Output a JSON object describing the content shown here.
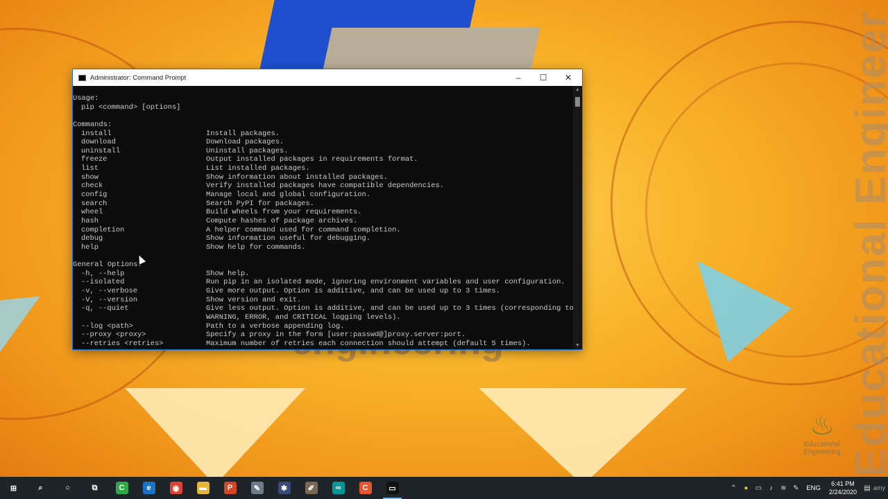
{
  "window": {
    "title": "Administrator: Command Prompt",
    "controls": {
      "minimize": "–",
      "maximize": "☐",
      "close": "✕"
    }
  },
  "console": {
    "usage_header": "Usage:",
    "usage_line": "pip <command> [options]",
    "commands_header": "Commands:",
    "commands": [
      {
        "name": "install",
        "desc": "Install packages."
      },
      {
        "name": "download",
        "desc": "Download packages."
      },
      {
        "name": "uninstall",
        "desc": "Uninstall packages."
      },
      {
        "name": "freeze",
        "desc": "Output installed packages in requirements format."
      },
      {
        "name": "list",
        "desc": "List installed packages."
      },
      {
        "name": "show",
        "desc": "Show information about installed packages."
      },
      {
        "name": "check",
        "desc": "Verify installed packages have compatible dependencies."
      },
      {
        "name": "config",
        "desc": "Manage local and global configuration."
      },
      {
        "name": "search",
        "desc": "Search PyPI for packages."
      },
      {
        "name": "wheel",
        "desc": "Build wheels from your requirements."
      },
      {
        "name": "hash",
        "desc": "Compute hashes of package archives."
      },
      {
        "name": "completion",
        "desc": "A helper command used for command completion."
      },
      {
        "name": "debug",
        "desc": "Show information useful for debugging."
      },
      {
        "name": "help",
        "desc": "Show help for commands."
      }
    ],
    "options_header": "General Options:",
    "options": [
      {
        "name": "-h, --help",
        "desc": "Show help."
      },
      {
        "name": "--isolated",
        "desc": "Run pip in an isolated mode, ignoring environment variables and user configuration."
      },
      {
        "name": "-v, --verbose",
        "desc": "Give more output. Option is additive, and can be used up to 3 times."
      },
      {
        "name": "-V, --version",
        "desc": "Show version and exit."
      },
      {
        "name": "-q, --quiet",
        "desc": "Give less output. Option is additive, and can be used up to 3 times (corresponding to"
      },
      {
        "name": "",
        "desc": "WARNING, ERROR, and CRITICAL logging levels)."
      },
      {
        "name": "--log <path>",
        "desc": "Path to a verbose appending log."
      },
      {
        "name": "--proxy <proxy>",
        "desc": "Specify a proxy in the form [user:passwd@]proxy.server:port."
      },
      {
        "name": "--retries <retries>",
        "desc": "Maximum number of retries each connection should attempt (default 5 times)."
      }
    ]
  },
  "wallpaper": {
    "text_right": "Educational Engineer",
    "text_bottom": "engineering",
    "logo_line1": "Educational",
    "logo_line2": "Engineering"
  },
  "taskbar": {
    "items": [
      {
        "name": "start-button",
        "icon": "windows-logo",
        "glyph": "⊞",
        "color": "#1f2429",
        "active": false
      },
      {
        "name": "search-button",
        "icon": "search-icon",
        "glyph": "⌕",
        "color": "#1f2429",
        "active": false
      },
      {
        "name": "cortana-button",
        "icon": "cortana-icon",
        "glyph": "○",
        "color": "#1f2429",
        "active": false
      },
      {
        "name": "task-view-button",
        "icon": "task-view-icon",
        "glyph": "⧉",
        "color": "#1f2429",
        "active": false
      },
      {
        "name": "taskbar-app-camtasia",
        "icon": "camtasia-icon",
        "glyph": "C",
        "color": "#2fa84a",
        "active": false
      },
      {
        "name": "taskbar-app-edge",
        "icon": "edge-icon",
        "glyph": "e",
        "color": "#1a73c9",
        "active": false
      },
      {
        "name": "taskbar-app-chrome",
        "icon": "chrome-icon",
        "glyph": "◉",
        "color": "#db4437",
        "active": false
      },
      {
        "name": "taskbar-app-file-explorer",
        "icon": "folder-icon",
        "glyph": "▬",
        "color": "#e8b53a",
        "active": false
      },
      {
        "name": "taskbar-app-powerpoint",
        "icon": "powerpoint-icon",
        "glyph": "P",
        "color": "#d24726",
        "active": false
      },
      {
        "name": "taskbar-app-tool",
        "icon": "tool-icon",
        "glyph": "✎",
        "color": "#6d7b8a",
        "active": false
      },
      {
        "name": "taskbar-app-settings",
        "icon": "gear-icon",
        "glyph": "✱",
        "color": "#394a7a",
        "active": false
      },
      {
        "name": "taskbar-app-paint",
        "icon": "paint-icon",
        "glyph": "✐",
        "color": "#7a6a55",
        "active": false
      },
      {
        "name": "taskbar-app-arduino",
        "icon": "arduino-icon",
        "glyph": "∞",
        "color": "#00979c",
        "active": false
      },
      {
        "name": "taskbar-app-camtasia-recorder",
        "icon": "camtasia-recorder-icon",
        "glyph": "C",
        "color": "#e4572e",
        "active": false
      },
      {
        "name": "taskbar-app-command-prompt",
        "icon": "terminal-icon",
        "glyph": "▭",
        "color": "#111111",
        "active": true
      }
    ],
    "tray": {
      "language": "ENG",
      "time": "6:41 PM",
      "date": "2/24/2020",
      "user_label": "amy"
    }
  }
}
